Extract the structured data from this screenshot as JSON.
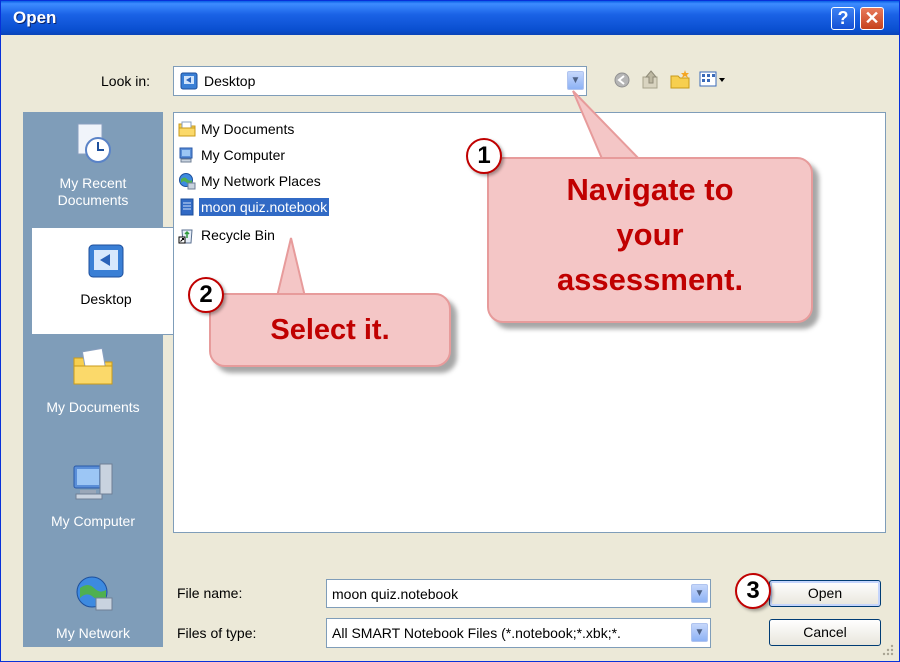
{
  "window": {
    "title": "Open"
  },
  "toolbar": {
    "look_in_label": "Look in:",
    "look_in_value": "Desktop"
  },
  "places": [
    {
      "label": "My Recent Documents"
    },
    {
      "label": "Desktop"
    },
    {
      "label": "My Documents"
    },
    {
      "label": "My Computer"
    },
    {
      "label": "My Network"
    }
  ],
  "files": [
    {
      "name": "My Documents",
      "icon": "folder-icon"
    },
    {
      "name": "My Computer",
      "icon": "computer-icon"
    },
    {
      "name": "My Network Places",
      "icon": "network-icon"
    },
    {
      "name": "moon quiz.notebook",
      "icon": "notebook-file-icon",
      "selected": true
    },
    {
      "name": "Recycle Bin",
      "icon": "recycle-bin-icon"
    }
  ],
  "form": {
    "file_name_label": "File name:",
    "file_name_value": "moon quiz.notebook",
    "file_type_label": "Files of type:",
    "file_type_value": "All SMART Notebook Files (*.notebook;*.xbk;*."
  },
  "buttons": {
    "open": "Open",
    "cancel": "Cancel"
  },
  "annotations": {
    "step1_number": "1",
    "step1_text": "Navigate to your assessment.",
    "step2_number": "2",
    "step2_text": "Select it.",
    "step3_number": "3"
  },
  "colors": {
    "titlebar": "#0a4fd0",
    "selection": "#316ac5",
    "callout_fill": "#f4c6c6",
    "callout_text": "#c00000"
  }
}
